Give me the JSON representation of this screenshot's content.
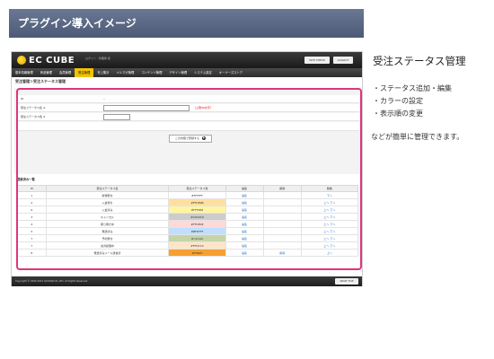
{
  "banner": {
    "title": "プラグイン導入イメージ"
  },
  "app": {
    "logo_text": "EC CUBE",
    "login_info": "ログイン : 管理者 様",
    "site_check_label": "SITE CHECK",
    "logout_label": "LOGOUT",
    "nav": [
      "基本情報管理",
      "商品管理",
      "会員管理",
      "受注管理",
      "売上集計",
      "メルマガ管理",
      "コンテンツ管理",
      "デザイン管理",
      "システム設定",
      "オーナーズストア"
    ],
    "breadcrumb": "受注管理＞受注ステータス管理",
    "form": {
      "id_label": "ID",
      "id_value": "--",
      "name_label": "受注ステータス名 ※",
      "name_note": "（上限40文字）",
      "color_label": "受注ステータス色 ※",
      "save_label": "この内容で登録する",
      "save_arrow": "▶"
    },
    "list_heading": "登録済み一覧",
    "table": {
      "headers": [
        "ID",
        "受注ステータス名",
        "受注ステータス色",
        "編集",
        "削除",
        "移動"
      ],
      "rows": [
        {
          "id": "1",
          "name": "新規受付",
          "color": "#FFFFFF",
          "edit": "編集",
          "delete": "",
          "move": "下へ"
        },
        {
          "id": "2",
          "name": "入金待ち",
          "color": "#FFDE9B",
          "edit": "編集",
          "delete": "",
          "move": "上へ 下へ"
        },
        {
          "id": "6",
          "name": "入金済み",
          "color": "#FFF468",
          "edit": "編集",
          "delete": "",
          "move": "上へ 下へ"
        },
        {
          "id": "3",
          "name": "キャンセル",
          "color": "#C9C9C9",
          "edit": "編集",
          "delete": "",
          "move": "上へ 下へ"
        },
        {
          "id": "4",
          "name": "取り寄せ中",
          "color": "#FFDE0E",
          "edit": "編集",
          "delete": "",
          "move": "上へ 下へ"
        },
        {
          "id": "5",
          "name": "発送済み",
          "color": "#BFDFFF",
          "edit": "編集",
          "delete": "",
          "move": "上へ 下へ"
        },
        {
          "id": "7",
          "name": "予約受付",
          "color": "#c4c1a5",
          "edit": "編集",
          "delete": "",
          "move": "上へ 下へ"
        },
        {
          "id": "7",
          "name": "決済処理中",
          "color": "#FFDCCC",
          "edit": "編集",
          "delete": "",
          "move": "上へ 下へ"
        },
        {
          "id": "8",
          "name": "発送済みメール送信済",
          "color": "#F9620",
          "edit": "編集",
          "delete": "削除",
          "move": "上へ"
        }
      ]
    },
    "copyright": "Copyright © 2000-2013 LOCKON CO.,LTD. All Rights Reserved.",
    "pagetop_label": "PAGE TOP"
  },
  "side": {
    "title": "受注ステータス管理",
    "items": [
      "・ステータス追加・編集",
      "・カラーの設定",
      "・表示順の変更"
    ],
    "note": "などが簡単に管理できます。"
  },
  "colors": {
    "highlight": "#e0357a",
    "banner": "#5b6985",
    "active_nav": "#f0c300",
    "swatches": [
      "#ffffff",
      "#ffdfa0",
      "#fff4a0",
      "#cccccc",
      "#ffd8d8",
      "#bfdfff",
      "#c4d4a8",
      "#ffe4c8",
      "#f5a030"
    ]
  }
}
